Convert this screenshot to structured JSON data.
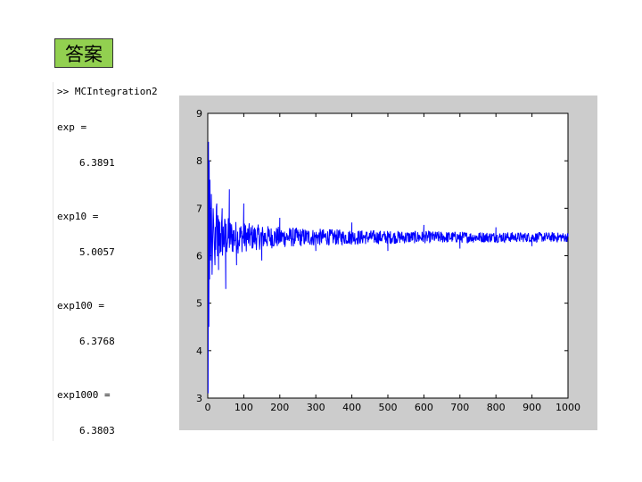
{
  "answer_label": "答案",
  "console": {
    "command": ">> MCIntegration2",
    "lines": [
      {
        "label": "exp =",
        "value": "6.3891"
      },
      {
        "label": "exp10 =",
        "value": "5.0057"
      },
      {
        "label": "exp100 =",
        "value": "6.3768"
      },
      {
        "label": "exp1000 =",
        "value": "6.3803"
      }
    ]
  },
  "colors": {
    "answer_tag_bg": "#92d050",
    "figure_bg": "#cccccc",
    "axes_bg": "#ffffff",
    "series": "#0000ff"
  },
  "chart_data": {
    "type": "line",
    "title": "",
    "xlabel": "",
    "ylabel": "",
    "xlim": [
      0,
      1000
    ],
    "ylim": [
      3,
      9
    ],
    "xticks": [
      0,
      100,
      200,
      300,
      400,
      500,
      600,
      700,
      800,
      900,
      1000
    ],
    "xtick_labels": [
      "0",
      "100",
      "200",
      "300",
      "400",
      "500",
      "600",
      "700",
      "800",
      "900",
      "1000"
    ],
    "yticks": [
      3,
      4,
      5,
      6,
      7,
      8,
      9
    ],
    "ytick_labels": [
      "3",
      "4",
      "5",
      "6",
      "7",
      "8",
      "9"
    ],
    "grid": false,
    "series": [
      {
        "x": [
          1,
          2,
          3,
          4,
          5,
          6,
          8,
          10,
          12,
          15,
          20,
          25,
          30,
          40,
          50,
          60,
          80,
          100,
          150,
          200,
          300,
          400,
          500,
          600,
          700,
          800,
          900,
          1000
        ],
        "y": [
          3.1,
          8.4,
          4.5,
          8.0,
          5.5,
          7.6,
          5.9,
          7.3,
          5.6,
          7.0,
          5.8,
          7.1,
          5.7,
          7.0,
          5.3,
          7.4,
          5.8,
          7.1,
          5.9,
          6.8,
          6.1,
          6.7,
          6.1,
          6.65,
          6.15,
          6.6,
          6.2,
          6.4
        ],
        "count": 1000,
        "converges_to": 6.39
      }
    ]
  }
}
